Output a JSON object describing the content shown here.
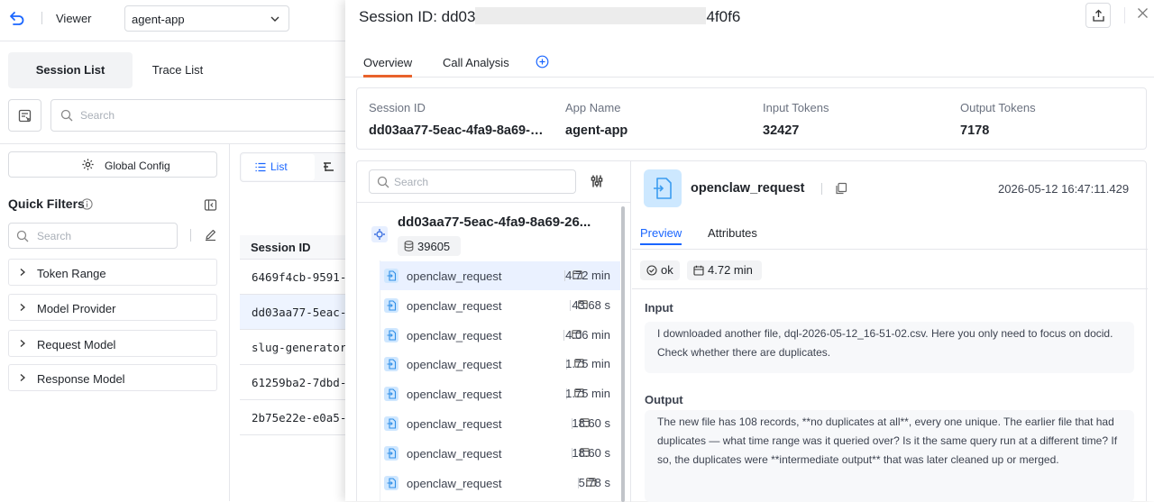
{
  "topbar": {
    "viewer_label": "Viewer",
    "app_selected": "agent-app"
  },
  "list_tabs": [
    {
      "label": "Session List",
      "active": true
    },
    {
      "label": "Trace List",
      "active": false
    }
  ],
  "search": {
    "placeholder": "Search"
  },
  "sidebar": {
    "global_config_label": "Global Config",
    "quick_filters_title": "Quick Filters",
    "filter_search_placeholder": "Search",
    "facets": [
      "Token Range",
      "Model Provider",
      "Request Model",
      "Response Model"
    ]
  },
  "view_toggle": {
    "list_label": "List"
  },
  "sessions": {
    "column_header": "Session ID",
    "rows": [
      {
        "id": "6469f4cb-9591-",
        "selected": false
      },
      {
        "id": "dd03aa77-5eac-",
        "selected": true
      },
      {
        "id": "slug-generator",
        "selected": false
      },
      {
        "id": "61259ba2-7dbd-",
        "selected": false
      },
      {
        "id": "2b75e22e-e0a5-",
        "selected": false
      }
    ]
  },
  "drawer": {
    "title_prefix": "Session ID: dd03",
    "title_suffix": "4f0f6",
    "tabs": [
      {
        "label": "Overview",
        "active": true
      },
      {
        "label": "Call Analysis",
        "active": false
      }
    ],
    "summary": [
      {
        "label": "Session ID",
        "value": "dd03aa77-5eac-4fa9-8a69-26..."
      },
      {
        "label": "App Name",
        "value": "agent-app"
      },
      {
        "label": "Input Tokens",
        "value": "32427"
      },
      {
        "label": "Output Tokens",
        "value": "7178"
      }
    ],
    "tree": {
      "search_placeholder": "Search",
      "root_title": "dd03aa77-5eac-4fa9-8a69-26...",
      "root_tokens": "39605",
      "spans": [
        {
          "name": "openclaw_request",
          "duration": "4.72 min",
          "selected": true
        },
        {
          "name": "openclaw_request",
          "duration": "43.68 s",
          "selected": false
        },
        {
          "name": "openclaw_request",
          "duration": "4.06 min",
          "selected": false
        },
        {
          "name": "openclaw_request",
          "duration": "1.75 min",
          "selected": false
        },
        {
          "name": "openclaw_request",
          "duration": "1.75 min",
          "selected": false
        },
        {
          "name": "openclaw_request",
          "duration": "18.60 s",
          "selected": false
        },
        {
          "name": "openclaw_request",
          "duration": "18.60 s",
          "selected": false
        },
        {
          "name": "openclaw_request",
          "duration": "5.78 s",
          "selected": false
        }
      ]
    },
    "detail": {
      "name": "openclaw_request",
      "timestamp": "2026-05-12 16:47:11.429",
      "tabs": [
        {
          "label": "Preview",
          "active": true
        },
        {
          "label": "Attributes",
          "active": false
        }
      ],
      "status": "ok",
      "duration": "4.72 min",
      "input_title": "Input",
      "input_text": "I downloaded another file, dql-2026-05-12_16-51-02.csv. Here you only need to focus on docid. Check whether there are duplicates.",
      "output_title": "Output",
      "output_text": "The new file has 108 records, **no duplicates at all**, every one unique. The earlier file that had duplicates — what time range was it queried over? Is it the same query run at a different time? If so, the duplicates were **intermediate output** that was later cleaned up or merged."
    }
  },
  "colors": {
    "accent": "#1a66ff",
    "tab_active": "#e8622b",
    "selection": "#eaf1ff"
  }
}
